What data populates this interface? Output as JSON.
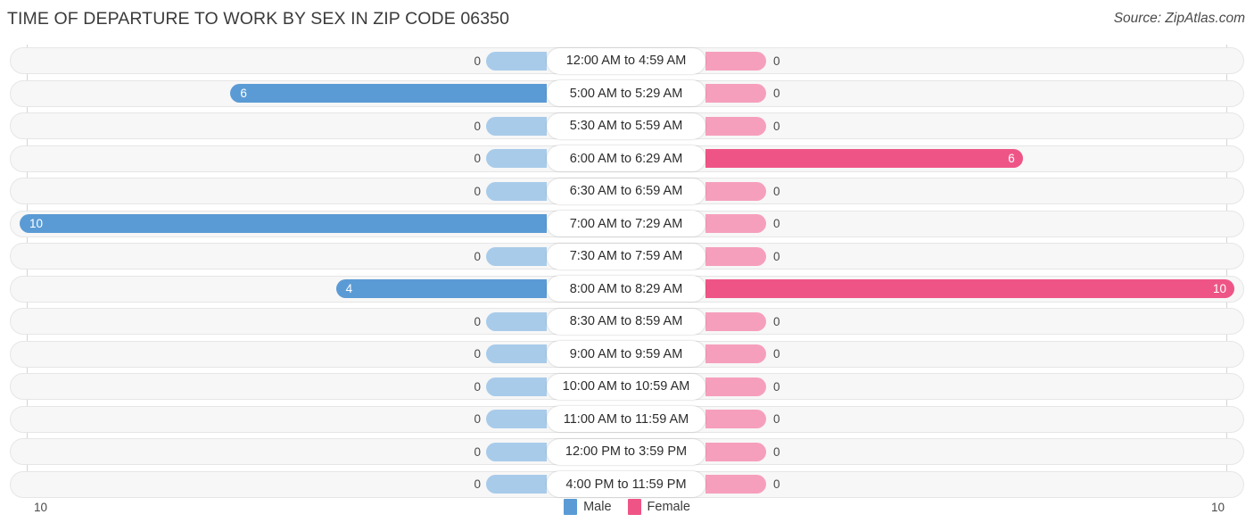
{
  "header": {
    "title": "TIME OF DEPARTURE TO WORK BY SEX IN ZIP CODE 06350",
    "source": "Source: ZipAtlas.com"
  },
  "footer": {
    "axis_left": "10",
    "axis_right": "10",
    "legend": [
      {
        "label": "Male",
        "color": "#5b9bd5"
      },
      {
        "label": "Female",
        "color": "#ee5586"
      }
    ]
  },
  "chart_data": {
    "type": "bar",
    "orientation": "horizontal-diverging",
    "title": "TIME OF DEPARTURE TO WORK BY SEX IN ZIP CODE 06350",
    "xlabel": "",
    "ylabel": "",
    "xlim": [
      10,
      10
    ],
    "grid": true,
    "legend_position": "bottom-center",
    "categories": [
      "12:00 AM to 4:59 AM",
      "5:00 AM to 5:29 AM",
      "5:30 AM to 5:59 AM",
      "6:00 AM to 6:29 AM",
      "6:30 AM to 6:59 AM",
      "7:00 AM to 7:29 AM",
      "7:30 AM to 7:59 AM",
      "8:00 AM to 8:29 AM",
      "8:30 AM to 8:59 AM",
      "9:00 AM to 9:59 AM",
      "10:00 AM to 10:59 AM",
      "11:00 AM to 11:59 AM",
      "12:00 PM to 3:59 PM",
      "4:00 PM to 11:59 PM"
    ],
    "series": [
      {
        "name": "Male",
        "color": "#5b9bd5",
        "side": "left",
        "values": [
          0,
          6,
          0,
          0,
          0,
          10,
          0,
          4,
          0,
          0,
          0,
          0,
          0,
          0
        ],
        "labels": [
          "0",
          "6",
          "0",
          "0",
          "0",
          "10",
          "0",
          "4",
          "0",
          "0",
          "0",
          "0",
          "0",
          "0"
        ]
      },
      {
        "name": "Female",
        "color": "#ee5586",
        "side": "right",
        "values": [
          0,
          0,
          0,
          6,
          0,
          0,
          0,
          10,
          0,
          0,
          0,
          0,
          0,
          0
        ],
        "labels": [
          "0",
          "0",
          "0",
          "6",
          "0",
          "0",
          "0",
          "10",
          "0",
          "0",
          "0",
          "0",
          "0",
          "0"
        ]
      }
    ],
    "max_value": 10
  }
}
